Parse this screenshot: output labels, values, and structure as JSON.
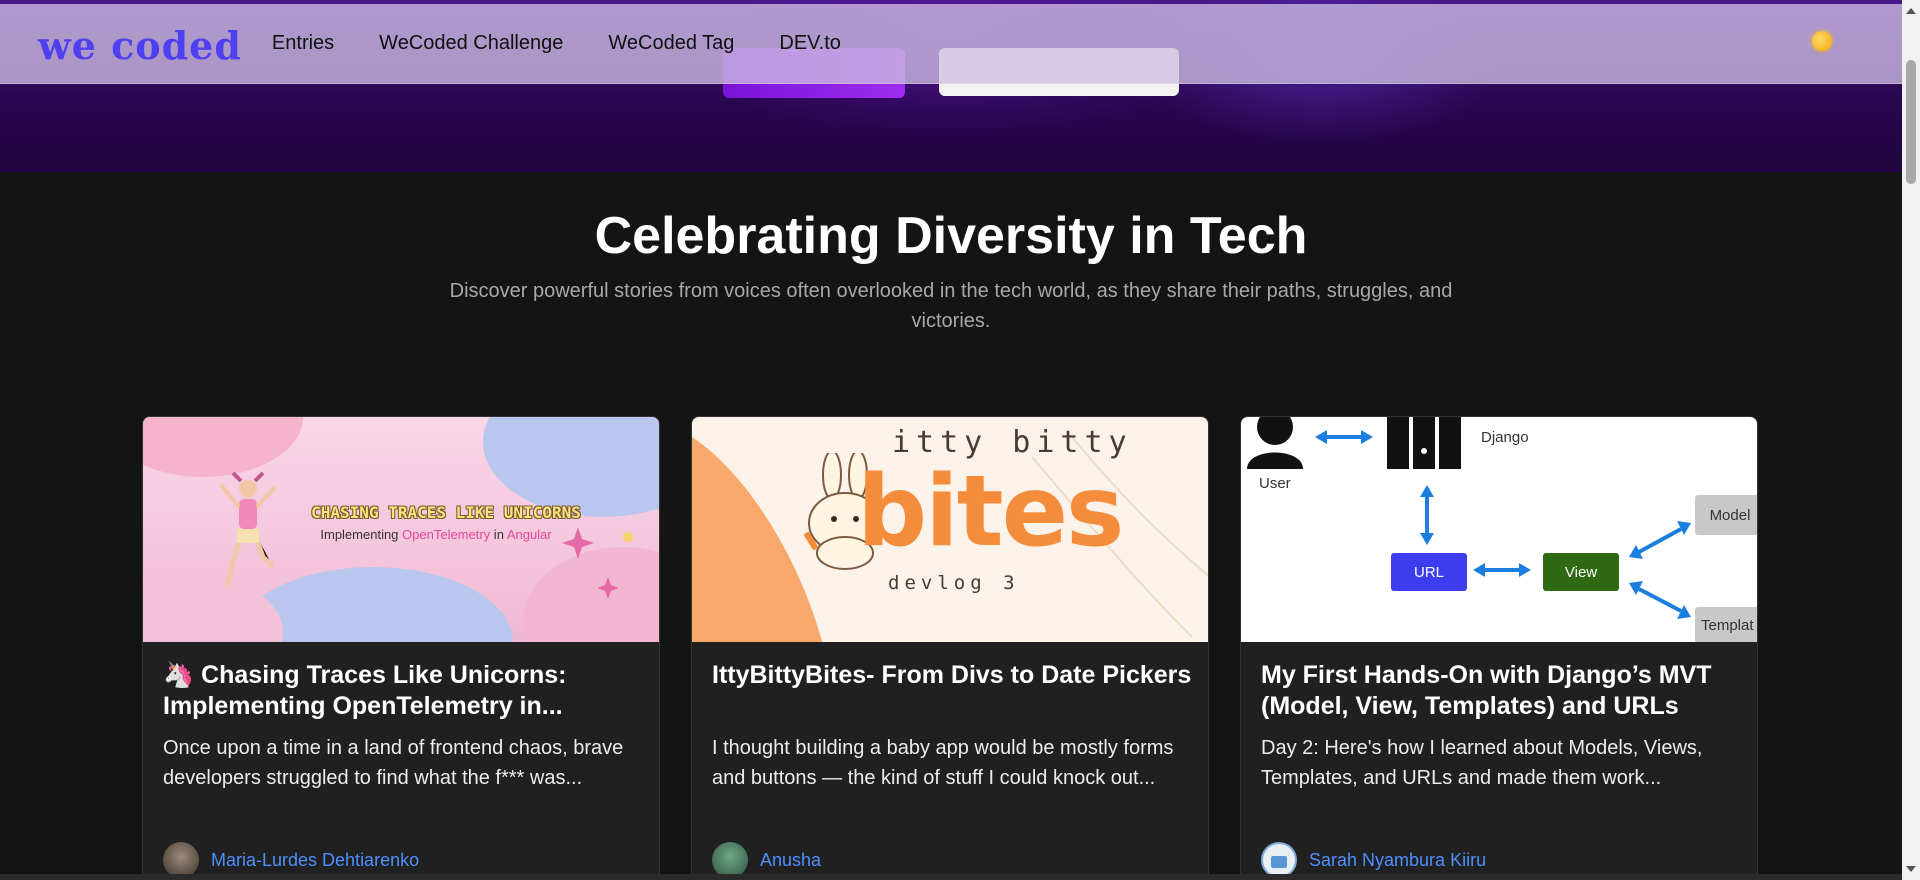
{
  "nav": {
    "logo": "we coded",
    "links": [
      "Entries",
      "WeCoded Challenge",
      "WeCoded Tag",
      "DEV.to"
    ],
    "theme_icon": "sun-icon"
  },
  "section": {
    "title": "Celebrating Diversity in Tech",
    "subtitle": "Discover powerful stories from voices often overlooked in the tech world, as they share their paths, struggles, and victories."
  },
  "cards": [
    {
      "title": "🦄 Chasing Traces Like Unicorns: Implementing OpenTelemetry in...",
      "description": "Once upon a time in a land of frontend chaos, brave developers struggled to find what the f*** was...",
      "author": "Maria-Lurdes Dehtiarenko",
      "image": {
        "line1": "CHASING TRACES LIKE UNICORNS",
        "line2_a": "Implementing ",
        "line2_b": "OpenTelemetry",
        "line2_c": " in ",
        "line2_d": "Angular"
      }
    },
    {
      "title": "IttyBittyBites- From Divs to Date Pickers",
      "description": "I thought building a baby app would be mostly forms and buttons — the kind of stuff I could knock out...",
      "author": "Anusha",
      "image": {
        "line1": "itty bitty",
        "line2": "bites",
        "line3": "devlog 3"
      }
    },
    {
      "title": "My First Hands-On with Django’s MVT (Model, View, Templates) and URLs",
      "description": "Day 2: Here's how I learned about Models, Views, Templates, and URLs and made them work...",
      "author": "Sarah Nyambura Kiiru",
      "image": {
        "user": "User",
        "django": "Django",
        "url": "URL",
        "view": "View",
        "model": "Model",
        "template": "Templat"
      }
    }
  ]
}
